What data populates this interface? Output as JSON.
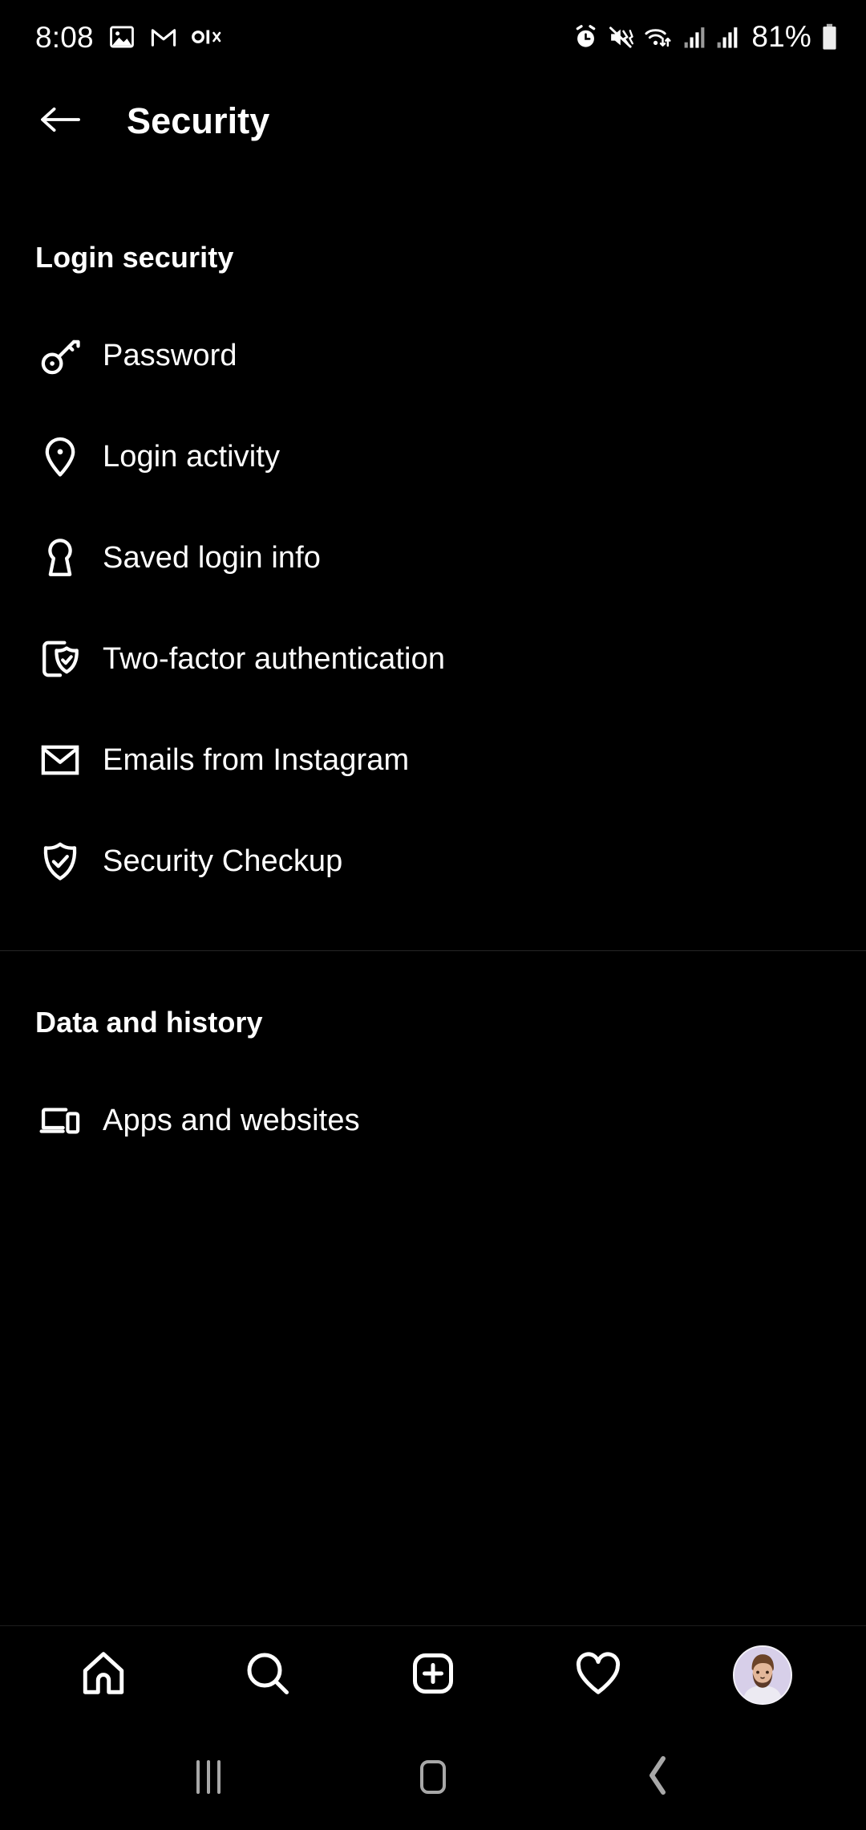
{
  "status_bar": {
    "time": "8:08",
    "left_icons": [
      "gallery-icon",
      "gmail-icon",
      "olx-icon"
    ],
    "right_icons": [
      "alarm-icon",
      "mute-vibrate-icon",
      "wifi-icon",
      "signal-sim1-icon",
      "signal-sim2-icon"
    ],
    "battery_percent": "81%"
  },
  "header": {
    "back_icon": "arrow-left-icon",
    "title": "Security"
  },
  "sections": [
    {
      "id": "login-security",
      "title": "Login security",
      "items": [
        {
          "icon": "key-icon",
          "label": "Password"
        },
        {
          "icon": "location-pin-icon",
          "label": "Login activity"
        },
        {
          "icon": "keyhole-icon",
          "label": "Saved login info"
        },
        {
          "icon": "phone-shield-check-icon",
          "label": "Two-factor authentication"
        },
        {
          "icon": "envelope-icon",
          "label": "Emails from Instagram"
        },
        {
          "icon": "shield-check-icon",
          "label": "Security Checkup"
        }
      ]
    },
    {
      "id": "data-and-history",
      "title": "Data and history",
      "items": [
        {
          "icon": "devices-icon",
          "label": "Apps and websites"
        }
      ]
    }
  ],
  "tab_bar": {
    "tabs": [
      {
        "id": "home",
        "icon": "home-icon"
      },
      {
        "id": "search",
        "icon": "search-icon"
      },
      {
        "id": "create",
        "icon": "plus-square-icon"
      },
      {
        "id": "activity",
        "icon": "heart-icon"
      },
      {
        "id": "profile",
        "icon": "avatar-icon"
      }
    ]
  },
  "nav_bar": {
    "buttons": [
      {
        "id": "recents",
        "icon": "recents-icon"
      },
      {
        "id": "home",
        "icon": "nav-home-icon"
      },
      {
        "id": "back",
        "icon": "chevron-left-icon"
      }
    ]
  },
  "colors": {
    "background": "#000000",
    "text": "#ffffff",
    "divider": "#262626",
    "nav_icon": "#a8a8a8",
    "avatar_bg": "#d9d2ea"
  }
}
